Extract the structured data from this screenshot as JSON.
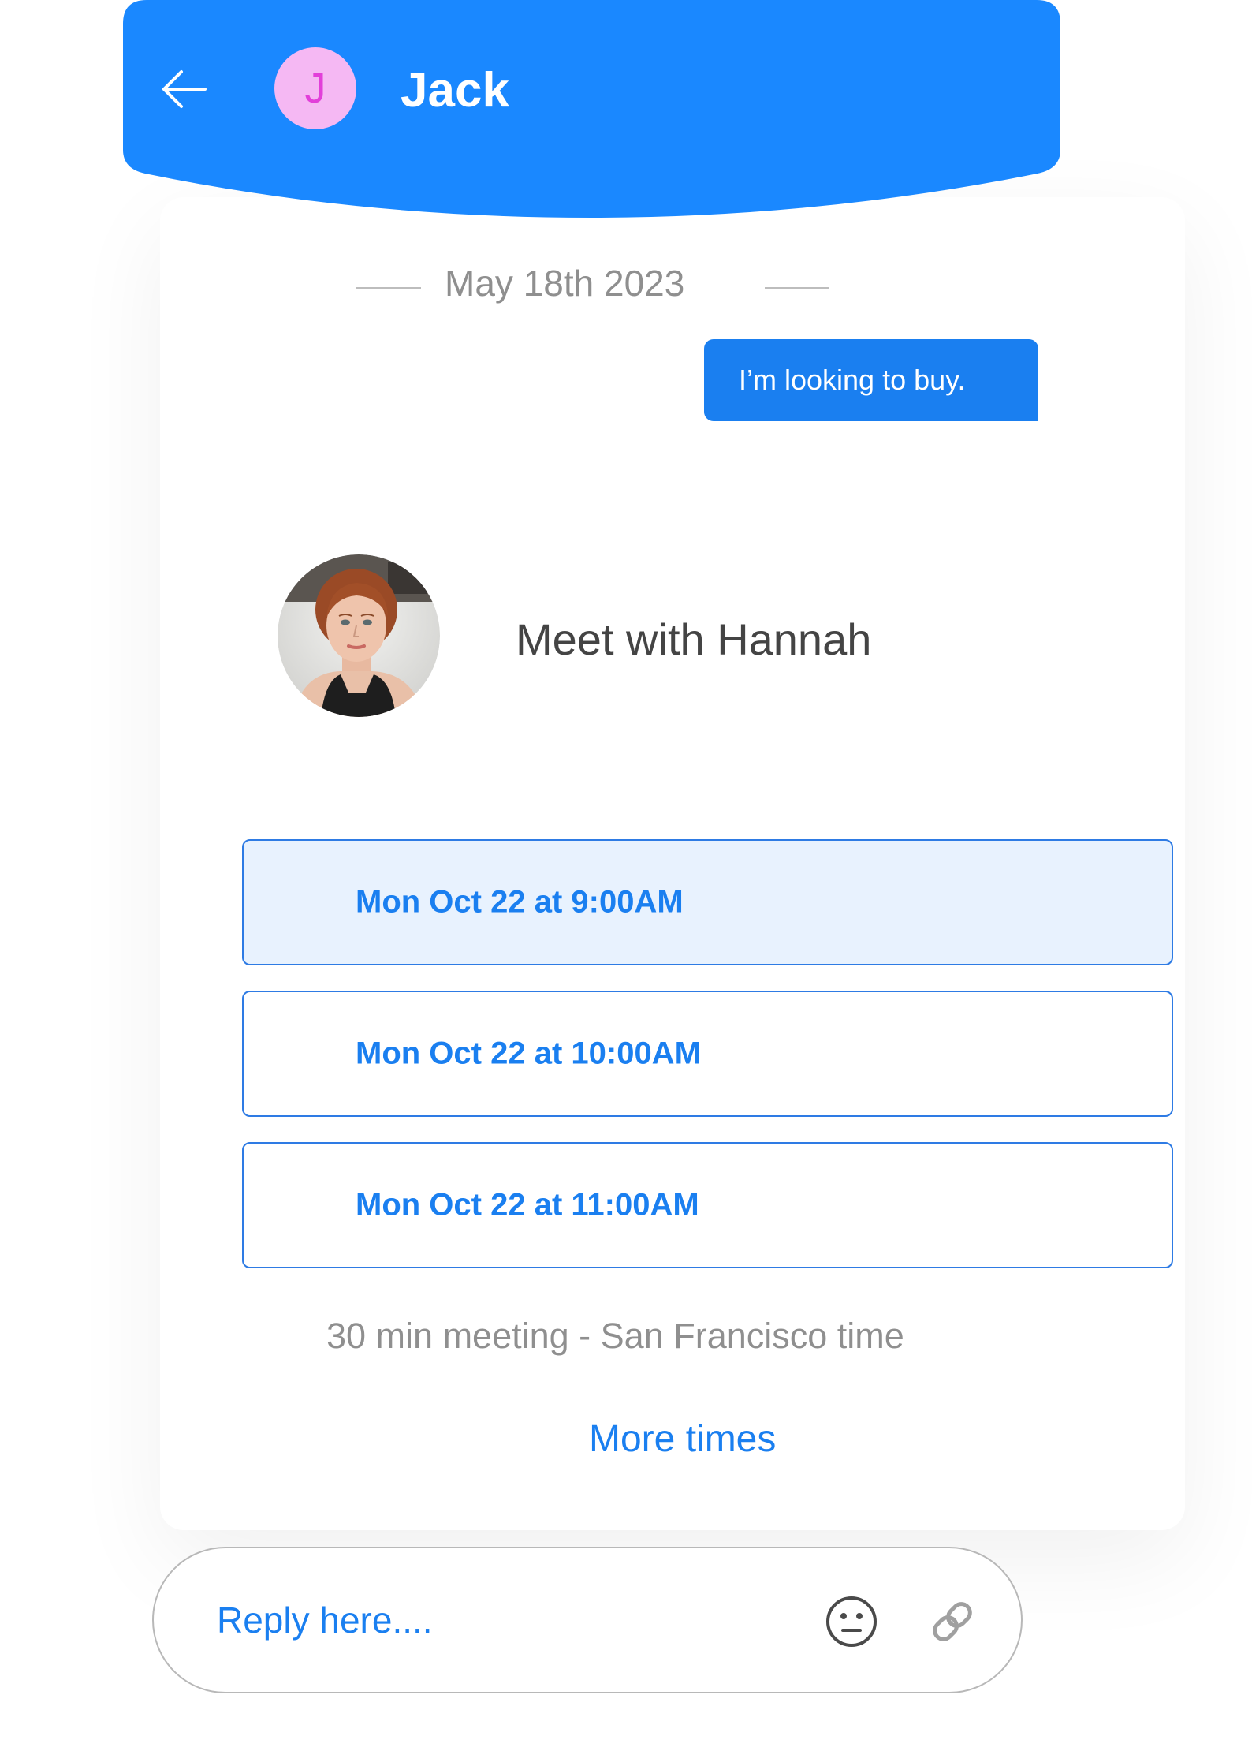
{
  "header": {
    "avatar_initial": "J",
    "name": "Jack"
  },
  "conversation": {
    "date": "May 18th 2023",
    "outgoing_message": "I’m looking to buy."
  },
  "scheduler": {
    "title": "Meet with Hannah",
    "slots": [
      {
        "label": "Mon Oct 22 at 9:00AM",
        "selected": true
      },
      {
        "label": "Mon Oct 22 at 10:00AM",
        "selected": false
      },
      {
        "label": "Mon Oct 22 at 11:00AM",
        "selected": false
      }
    ],
    "meeting_info": "30 min meeting - San Francisco time",
    "more_times": "More times"
  },
  "reply": {
    "placeholder": "Reply here...."
  },
  "colors": {
    "brand_blue": "#1a7ff0",
    "avatar_bg": "#f5b8f3",
    "avatar_text": "#e23fd9",
    "selected_slot_bg": "#e8f2fe"
  },
  "icons": {
    "back": "arrow-left-icon",
    "emoji": "neutral-face-icon",
    "attach": "paperclip-icon"
  }
}
